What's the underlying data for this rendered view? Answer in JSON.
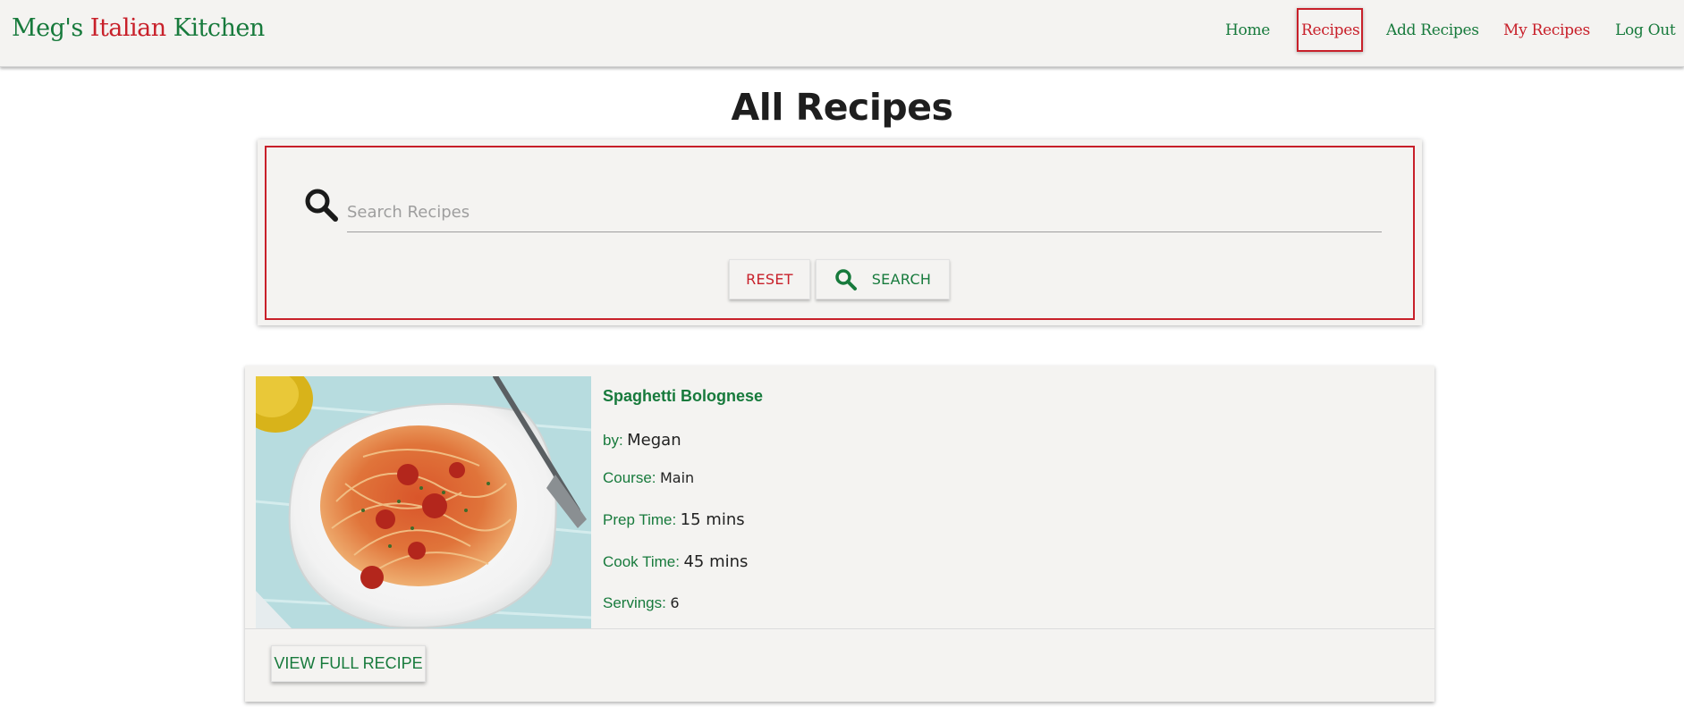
{
  "brand": {
    "part1": "Meg's ",
    "part2": "Italian",
    "part3": " Kitchen"
  },
  "nav": {
    "home": "Home",
    "recipes": "Recipes",
    "add_recipes": "Add Recipes",
    "my_recipes": "My Recipes",
    "log_out": "Log Out"
  },
  "page": {
    "title": "All Recipes"
  },
  "search": {
    "placeholder": "Search Recipes",
    "reset_label": "RESET",
    "search_label": "SEARCH"
  },
  "recipe": {
    "title": "Spaghetti Bolognese",
    "by_label": "by:",
    "by_value": "Megan",
    "course_label": "Course:",
    "course_value": "Main",
    "prep_label": "Prep Time:",
    "prep_value": "15 mins",
    "cook_label": "Cook Time:",
    "cook_value": "45 mins",
    "servings_label": "Servings:",
    "servings_value": "6",
    "view_label": "VIEW FULL RECIPE"
  },
  "colors": {
    "brand_green": "#177a3c",
    "brand_red": "#c8202a",
    "surface": "#f4f3f1"
  },
  "icons": {
    "search": "magnifier-icon"
  }
}
